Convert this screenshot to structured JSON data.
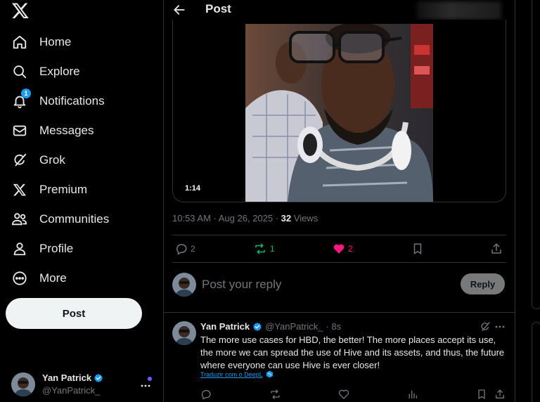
{
  "nav": {
    "items": [
      {
        "key": "home",
        "label": "Home",
        "icon": "home-icon"
      },
      {
        "key": "explore",
        "label": "Explore",
        "icon": "search-icon"
      },
      {
        "key": "notifications",
        "label": "Notifications",
        "icon": "bell-icon",
        "badge": "1"
      },
      {
        "key": "messages",
        "label": "Messages",
        "icon": "envelope-icon"
      },
      {
        "key": "grok",
        "label": "Grok",
        "icon": "grok-icon"
      },
      {
        "key": "premium",
        "label": "Premium",
        "icon": "x-logo-icon"
      },
      {
        "key": "communities",
        "label": "Communities",
        "icon": "people-icon"
      },
      {
        "key": "profile",
        "label": "Profile",
        "icon": "person-icon"
      },
      {
        "key": "more",
        "label": "More",
        "icon": "more-circle-icon"
      }
    ],
    "post_label": "Post"
  },
  "account": {
    "name": "Yan Patrick",
    "handle": "@YanPatrick_"
  },
  "header": {
    "title": "Post"
  },
  "post": {
    "video_duration": "1:14",
    "time": "10:53 AM · Aug 26, 2025 · ",
    "views_count": "32",
    "views_label": " Views",
    "replies": "2",
    "reposts": "1",
    "likes": "2"
  },
  "composer": {
    "placeholder": "Post your reply",
    "reply_label": "Reply"
  },
  "reply": {
    "name": "Yan Patrick",
    "handle": "@YanPatrick_",
    "time": "· 8s",
    "text": "The more use cases for HBD, the better! The more places accept its use, the more we can spread the use of Hive and its assets, and thus, the future where everyone can use Hive is ever closer!",
    "translate": "Traduzir com o DeepL"
  },
  "colors": {
    "accent": "#1d9bf0",
    "repost": "#00ba7c",
    "like": "#f91880",
    "muted": "#71767b",
    "border": "#2f3336"
  }
}
